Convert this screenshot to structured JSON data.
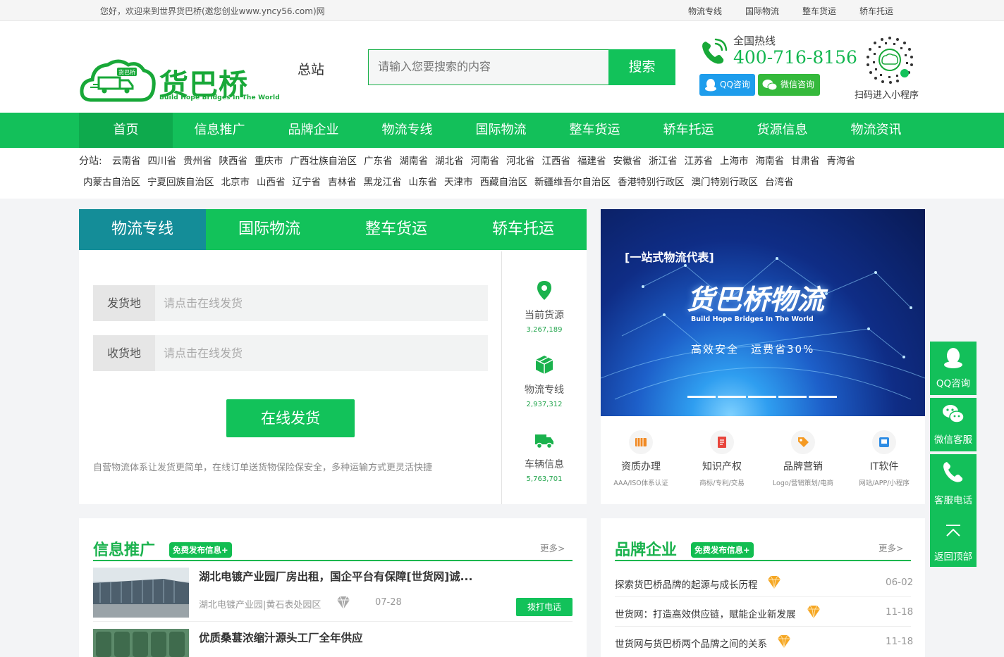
{
  "topbar": {
    "welcome": "您好，欢迎来到世界货巴桥(邀您创业www.yncy56.com)网",
    "links": [
      "物流专线",
      "国际物流",
      "整车货运",
      "轿车托运"
    ]
  },
  "header": {
    "logo_cn": "货巴桥",
    "logo_en": "Build Hope Bridges In The World",
    "logo_badge": "货巴桥",
    "station": "总站",
    "search_placeholder": "请输入您要搜索的内容",
    "search_button": "搜索",
    "hotline_label": "全国热线",
    "hotline_number": "400-716-8156",
    "qq_button": "QQ咨询",
    "wechat_button": "微信咨询",
    "qr_label": "扫码进入小程序"
  },
  "nav": [
    "首页",
    "信息推广",
    "品牌企业",
    "物流专线",
    "国际物流",
    "整车货运",
    "轿车托运",
    "货源信息",
    "物流资讯"
  ],
  "branches": {
    "label": "分站:",
    "row1": [
      "云南省",
      "四川省",
      "贵州省",
      "陕西省",
      "重庆市",
      "广西壮族自治区",
      "广东省",
      "湖南省",
      "湖北省",
      "河南省",
      "河北省",
      "江西省",
      "福建省",
      "安徽省",
      "浙江省",
      "江苏省",
      "上海市",
      "海南省",
      "甘肃省",
      "青海省"
    ],
    "row2": [
      "内蒙古自治区",
      "宁夏回族自治区",
      "北京市",
      "山西省",
      "辽宁省",
      "吉林省",
      "黑龙江省",
      "山东省",
      "天津市",
      "西藏自治区",
      "新疆维吾尔自治区",
      "香港特别行政区",
      "澳门特别行政区",
      "台湾省"
    ]
  },
  "panel": {
    "tabs": [
      "物流专线",
      "国际物流",
      "整车货运",
      "轿车托运"
    ],
    "from_label": "发货地",
    "from_placeholder": "请点击在线发货",
    "to_label": "收货地",
    "to_placeholder": "请点击在线发货",
    "submit": "在线发货",
    "description": "自营物流体系让发货更简单，在线订单送货物保险保安全，多种运输方式更灵活快捷",
    "stats": [
      {
        "label": "当前货源",
        "value": "3,267,189",
        "icon": "location-pin-icon"
      },
      {
        "label": "物流专线",
        "value": "2,937,312",
        "icon": "package-box-icon"
      },
      {
        "label": "车辆信息",
        "value": "5,763,701",
        "icon": "truck-icon"
      }
    ]
  },
  "banner": {
    "tag": "[一站式物流代表]",
    "title": "货巴桥物流",
    "subtitle": "Build Hope Bridges In The World",
    "slogan": "高效安全　运费省30%"
  },
  "services": [
    {
      "label": "资质办理",
      "sub": "AAA/ISO体系认证",
      "icon": "certificate-icon",
      "color": "#f08a24"
    },
    {
      "label": "知识产权",
      "sub": "商标/专利/交易",
      "icon": "document-icon",
      "color": "#e8453c"
    },
    {
      "label": "品牌营销",
      "sub": "Logo/营销策划/电商",
      "icon": "tag-icon",
      "color": "#f59a23"
    },
    {
      "label": "IT软件",
      "sub": "网站/APP/小程序",
      "icon": "software-icon",
      "color": "#2f8de4"
    }
  ],
  "info": {
    "title": "信息推广",
    "badge": "免费发布信息+",
    "more": "更多>",
    "items": [
      {
        "title": "湖北电镀产业园厂房出租，国企平台有保障[世货网]诚...",
        "location": "湖北电镀产业园|黄石表处园区",
        "date": "07-28",
        "button": "拨打电话"
      },
      {
        "title": "优质桑葚浓缩汁源头工厂全年供应",
        "location": "",
        "date": "",
        "button": ""
      }
    ]
  },
  "brand": {
    "title": "品牌企业",
    "badge": "免费发布信息+",
    "more": "更多>",
    "items": [
      {
        "title": "探索货巴桥品牌的起源与成长历程",
        "date": "06-02"
      },
      {
        "title": "世货网：打造高效供应链，赋能企业新发展",
        "date": "11-18"
      },
      {
        "title": "世货网与货巴桥两个品牌之间的关系",
        "date": "11-18"
      }
    ]
  },
  "sidebar": [
    {
      "label": "QQ咨询",
      "icon": "qq-penguin-icon"
    },
    {
      "label": "微信客服",
      "icon": "wechat-icon"
    },
    {
      "label": "客服电话",
      "icon": "phone-icon"
    },
    {
      "label": "返回顶部",
      "icon": "back-to-top-icon"
    }
  ],
  "colors": {
    "brand_green": "#13c05a",
    "tab_active_teal": "#148d98",
    "qq_blue": "#1e9dec"
  }
}
